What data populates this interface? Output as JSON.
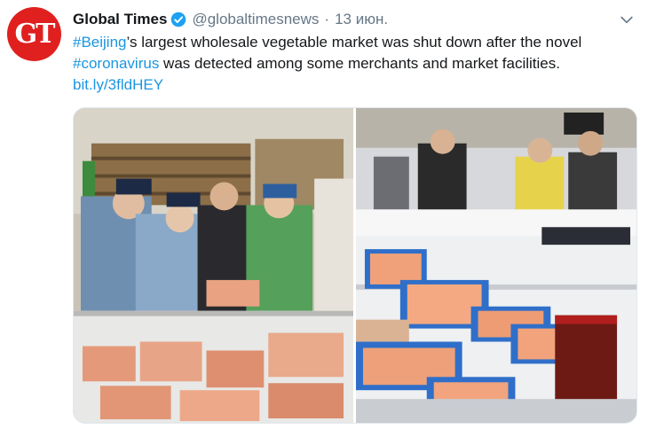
{
  "tweet": {
    "avatar_text": "GT",
    "display_name": "Global Times",
    "handle": "@globaltimesnews",
    "separator": "·",
    "timestamp": "13 июн.",
    "body": {
      "line1_hashtag": "#Beijing",
      "line1_rest": "’s largest wholesale vegetable market was shut down after the novel",
      "line2_hashtag": "#coronavirus",
      "line2_rest": " was detected among some merchants and market facilities.",
      "link": "bit.ly/3fldHEY"
    }
  },
  "colors": {
    "brand": "#e0201f",
    "link": "#1b95e0",
    "verified": "#1da1f2",
    "muted": "#657786"
  },
  "icons": [
    "verified-badge-icon",
    "chevron-down-icon"
  ],
  "media": {
    "count": 2
  }
}
